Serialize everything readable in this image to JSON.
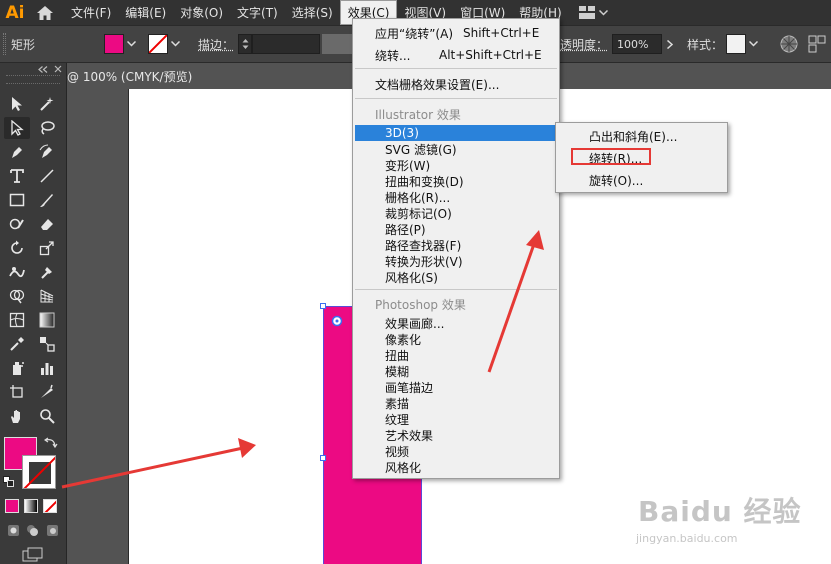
{
  "app": {
    "logo_text": "Ai",
    "document_tab": "@ 100% (CMYK/预览)",
    "menus": [
      "文件(F)",
      "编辑(E)",
      "对象(O)",
      "文字(T)",
      "选择(S)",
      "效果(C)",
      "视图(V)",
      "窗口(W)",
      "帮助(H)"
    ],
    "active_menu": "效果(C)"
  },
  "control_bar": {
    "object_label": "矩形",
    "stroke_label": "描边：",
    "opacity_label": "透明度：",
    "opacity_value": "100%",
    "style_label": "样式："
  },
  "effect_menu": {
    "apply_label": "应用“绕转”(A)",
    "apply_shortcut": "Shift+Ctrl+E",
    "revolve_label": "绕转...",
    "revolve_shortcut": "Alt+Shift+Ctrl+E",
    "raster_settings": "文档栅格效果设置(E)...",
    "illustrator_section": "Illustrator 效果",
    "illustrator_items": [
      "3D(3)",
      "SVG 滤镜(G)",
      "变形(W)",
      "扭曲和变换(D)",
      "栅格化(R)...",
      "裁剪标记(O)",
      "路径(P)",
      "路径查找器(F)",
      "转换为形状(V)",
      "风格化(S)"
    ],
    "highlighted_item": "3D(3)",
    "photoshop_section": "Photoshop 效果",
    "photoshop_items": [
      "效果画廊...",
      "像素化",
      "扭曲",
      "模糊",
      "画笔描边",
      "素描",
      "纹理",
      "艺术效果",
      "视频",
      "风格化"
    ]
  },
  "submenu_3d": {
    "items": [
      "凸出和斜角(E)...",
      "绕转(R)...",
      "旋转(O)..."
    ],
    "outlined_item": "绕转(R)..."
  },
  "watermark": {
    "logo": "Baidu 经验",
    "url": "jingyan.baidu.com"
  },
  "colors": {
    "fill": "#ec0a83",
    "highlight": "#2a82da",
    "annotation": "#e53935",
    "brand": "#ff9a00"
  }
}
